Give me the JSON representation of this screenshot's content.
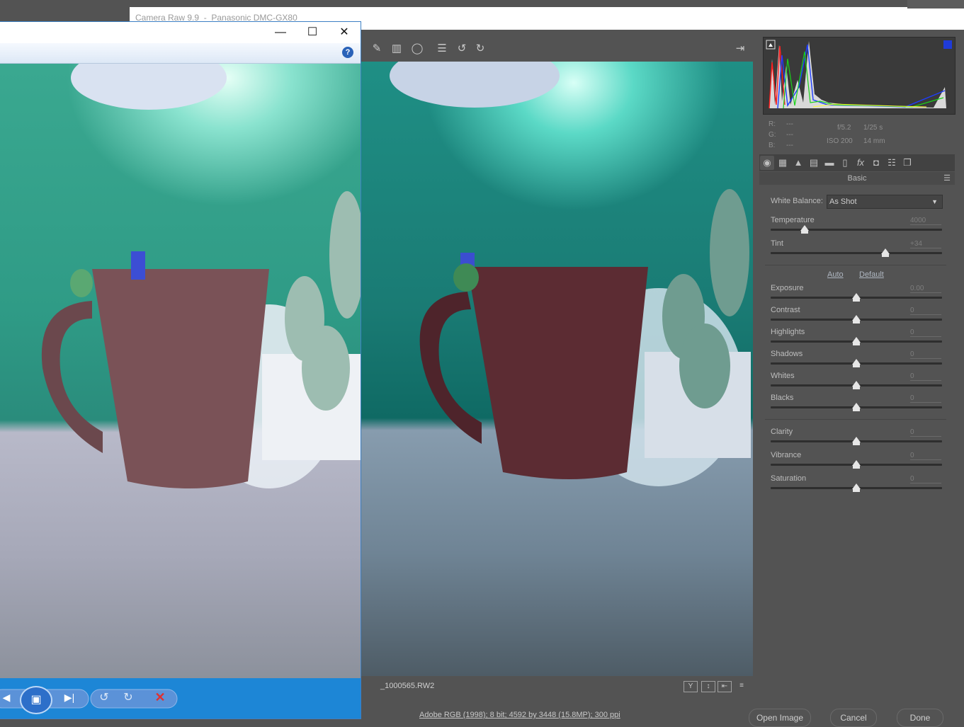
{
  "camera_raw": {
    "title": "Camera Raw 9.9  -  Panasonic DMC-GX80",
    "filename": "_1000565.RW2",
    "workflow_link": "Adobe RGB (1998); 8 bit; 4592 by 3448 (15.8MP); 300 ppi",
    "buttons": {
      "open_image": "Open Image",
      "cancel": "Cancel",
      "done": "Done"
    },
    "rgb": {
      "r_label": "R:",
      "r_value": "---",
      "g_label": "G:",
      "g_value": "---",
      "b_label": "B:",
      "b_value": "---"
    },
    "exif": {
      "aperture": "f/5.2",
      "shutter": "1/25 s",
      "iso": "ISO 200",
      "focal": "14 mm"
    },
    "panel_title": "Basic",
    "white_balance": {
      "label": "White Balance:",
      "value": "As Shot"
    },
    "links": {
      "auto": "Auto",
      "default": "Default"
    },
    "sliders": {
      "temperature": {
        "label": "Temperature",
        "value": "4000",
        "position": 0.2
      },
      "tint": {
        "label": "Tint",
        "value": "+34",
        "position": 0.67
      },
      "exposure": {
        "label": "Exposure",
        "value": "0.00",
        "position": 0.5
      },
      "contrast": {
        "label": "Contrast",
        "value": "0",
        "position": 0.5
      },
      "highlights": {
        "label": "Highlights",
        "value": "0",
        "position": 0.5
      },
      "shadows": {
        "label": "Shadows",
        "value": "0",
        "position": 0.5
      },
      "whites": {
        "label": "Whites",
        "value": "0",
        "position": 0.5
      },
      "blacks": {
        "label": "Blacks",
        "value": "0",
        "position": 0.5
      },
      "clarity": {
        "label": "Clarity",
        "value": "0",
        "position": 0.5
      },
      "vibrance": {
        "label": "Vibrance",
        "value": "0",
        "position": 0.5
      },
      "saturation": {
        "label": "Saturation",
        "value": "0",
        "position": 0.5
      }
    },
    "status_icons": [
      "Y",
      "↕",
      "⇤",
      "≡"
    ]
  },
  "photo_viewer": {
    "help": "?",
    "controls": {
      "minimize": "—",
      "maximize": "☐",
      "close": "✕"
    }
  },
  "colors": {
    "accent_blue": "#1d86d6",
    "panel_bg": "#535353",
    "delete_red": "#e03030"
  }
}
